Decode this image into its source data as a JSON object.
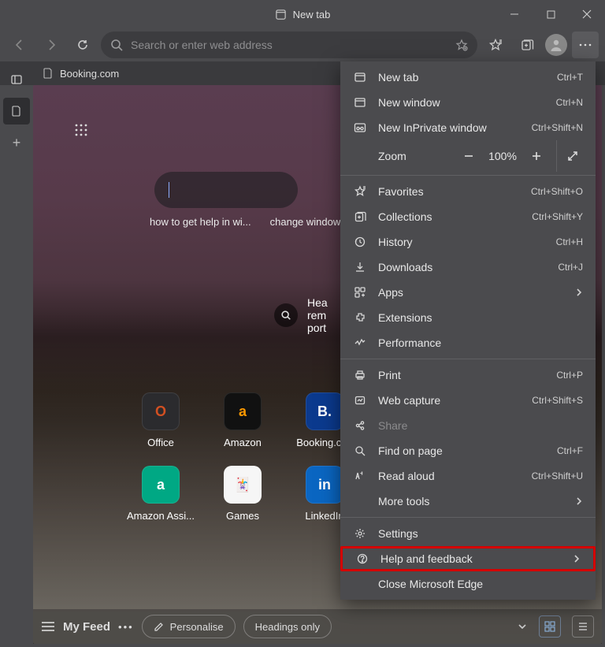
{
  "title": "New tab",
  "addressbar": {
    "placeholder": "Search or enter web address"
  },
  "tab": {
    "label": "Booking.com"
  },
  "suggestions": [
    "how to get help in wi...",
    "change windows"
  ],
  "weather": {
    "line1": "Hea",
    "line2": "rem",
    "line3": "port"
  },
  "tiles": [
    {
      "label": "Office",
      "icon_bg": "#2b2b2e",
      "icon_fg": "#d25022",
      "glyph": "O"
    },
    {
      "label": "Amazon",
      "icon_bg": "#111",
      "icon_fg": "#ff9900",
      "glyph": "a"
    },
    {
      "label": "Booking.con",
      "icon_bg": "#0b3a8e",
      "icon_fg": "#fff",
      "glyph": "B."
    },
    {
      "label": "Amazon Assi...",
      "icon_bg": "#00a884",
      "icon_fg": "#fff",
      "glyph": "a"
    },
    {
      "label": "Games",
      "icon_bg": "#f6f6f6",
      "icon_fg": "#1a6b1a",
      "glyph": "🃏"
    },
    {
      "label": "LinkedIn",
      "icon_bg": "#0a66c2",
      "icon_fg": "#fff",
      "glyph": "in"
    }
  ],
  "feed": {
    "title": "My Feed",
    "personalise": "Personalise",
    "headings": "Headings only"
  },
  "zoom": {
    "label": "Zoom",
    "value": "100%"
  },
  "menu": [
    {
      "type": "item",
      "icon": "tab",
      "label": "New tab",
      "shortcut": "Ctrl+T"
    },
    {
      "type": "item",
      "icon": "window",
      "label": "New window",
      "shortcut": "Ctrl+N"
    },
    {
      "type": "item",
      "icon": "inprivate",
      "label": "New InPrivate window",
      "shortcut": "Ctrl+Shift+N"
    },
    {
      "type": "zoom"
    },
    {
      "type": "sep"
    },
    {
      "type": "item",
      "icon": "star-plus",
      "label": "Favorites",
      "shortcut": "Ctrl+Shift+O"
    },
    {
      "type": "item",
      "icon": "collections",
      "label": "Collections",
      "shortcut": "Ctrl+Shift+Y"
    },
    {
      "type": "item",
      "icon": "history",
      "label": "History",
      "shortcut": "Ctrl+H"
    },
    {
      "type": "item",
      "icon": "download",
      "label": "Downloads",
      "shortcut": "Ctrl+J"
    },
    {
      "type": "item",
      "icon": "apps",
      "label": "Apps",
      "submenu": true
    },
    {
      "type": "item",
      "icon": "ext",
      "label": "Extensions"
    },
    {
      "type": "item",
      "icon": "perf",
      "label": "Performance"
    },
    {
      "type": "sep"
    },
    {
      "type": "item",
      "icon": "print",
      "label": "Print",
      "shortcut": "Ctrl+P"
    },
    {
      "type": "item",
      "icon": "capture",
      "label": "Web capture",
      "shortcut": "Ctrl+Shift+S"
    },
    {
      "type": "item",
      "icon": "share",
      "label": "Share",
      "disabled": true
    },
    {
      "type": "item",
      "icon": "find",
      "label": "Find on page",
      "shortcut": "Ctrl+F"
    },
    {
      "type": "item",
      "icon": "read",
      "label": "Read aloud",
      "shortcut": "Ctrl+Shift+U"
    },
    {
      "type": "item",
      "label": "More tools",
      "submenu": true,
      "noicon": true
    },
    {
      "type": "sep"
    },
    {
      "type": "item",
      "icon": "gear",
      "label": "Settings"
    },
    {
      "type": "item",
      "icon": "help",
      "label": "Help and feedback",
      "submenu": true,
      "highlight": true
    },
    {
      "type": "item",
      "label": "Close Microsoft Edge",
      "noicon": true
    }
  ]
}
